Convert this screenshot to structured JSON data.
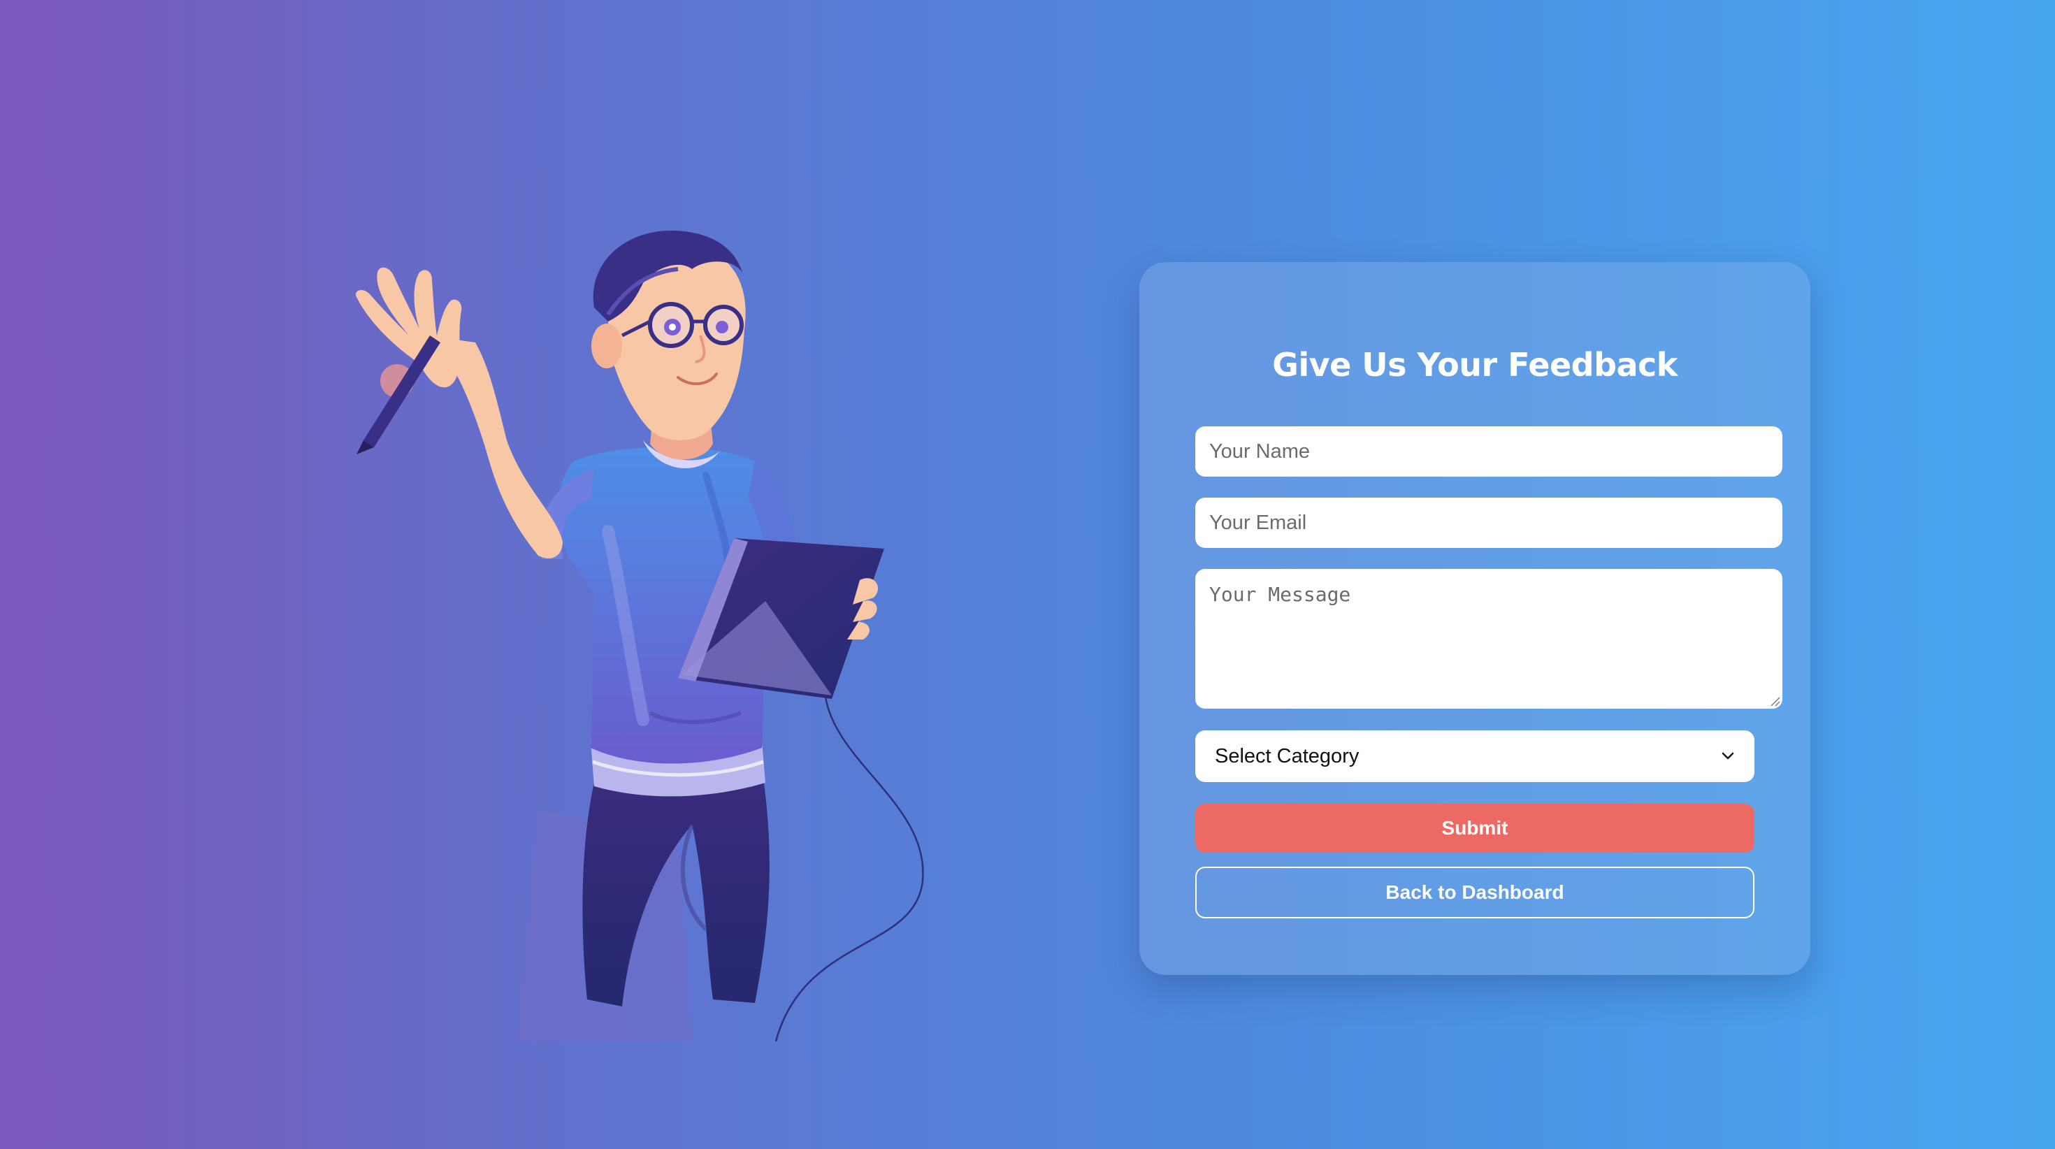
{
  "illustration": {
    "icon": "person-with-tablet-illustration"
  },
  "feedback_form": {
    "title": "Give Us Your Feedback",
    "name_placeholder": "Your Name",
    "name_value": "",
    "email_placeholder": "Your Email",
    "email_value": "",
    "message_placeholder": "Your Message",
    "message_value": "",
    "category_selected": "Select Category",
    "submit_label": "Submit",
    "back_label": "Back to Dashboard"
  },
  "colors": {
    "background_start": "#7b58bb",
    "background_end": "#48a6ef",
    "submit_button": "#ec6a63",
    "text_on_card": "#ffffff"
  }
}
